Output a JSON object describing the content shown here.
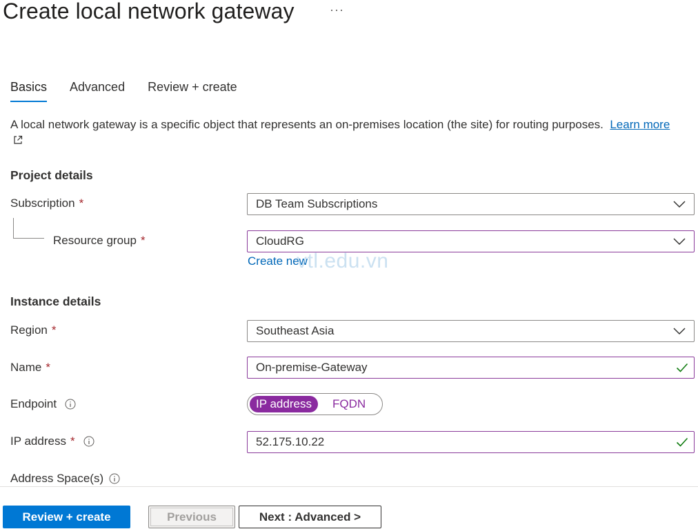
{
  "header": {
    "title": "Create local network gateway",
    "more_label": "···"
  },
  "tabs": [
    {
      "label": "Basics",
      "active": true
    },
    {
      "label": "Advanced",
      "active": false
    },
    {
      "label": "Review + create",
      "active": false
    }
  ],
  "description": {
    "text": "A local network gateway is a specific object that represents an on-premises location (the site) for routing purposes.",
    "link_part1": "Learn",
    "link_part2": "more"
  },
  "project_details": {
    "heading": "Project details",
    "subscription_label": "Subscription",
    "subscription_value": "DB Team Subscriptions",
    "resource_group_label": "Resource group",
    "resource_group_value": "CloudRG",
    "create_new": "Create new"
  },
  "watermark": "vtl.edu.vn",
  "instance_details": {
    "heading": "Instance details",
    "region_label": "Region",
    "region_value": "Southeast Asia",
    "name_label": "Name",
    "name_value": "On-premise-Gateway",
    "endpoint_label": "Endpoint",
    "endpoint_options": [
      "IP address",
      "FQDN"
    ],
    "endpoint_selected": "IP address",
    "ip_label": "IP address",
    "ip_value": "52.175.10.22",
    "address_space_label": "Address Space(s)"
  },
  "required_mark": "*",
  "footer": {
    "review_create": "Review + create",
    "previous": "Previous",
    "next": "Next : Advanced >"
  },
  "colors": {
    "accent": "#0078d4",
    "purple": "#8a2a9f",
    "required": "#a4262c",
    "valid_check": "#107c10",
    "link": "#0067b8"
  }
}
